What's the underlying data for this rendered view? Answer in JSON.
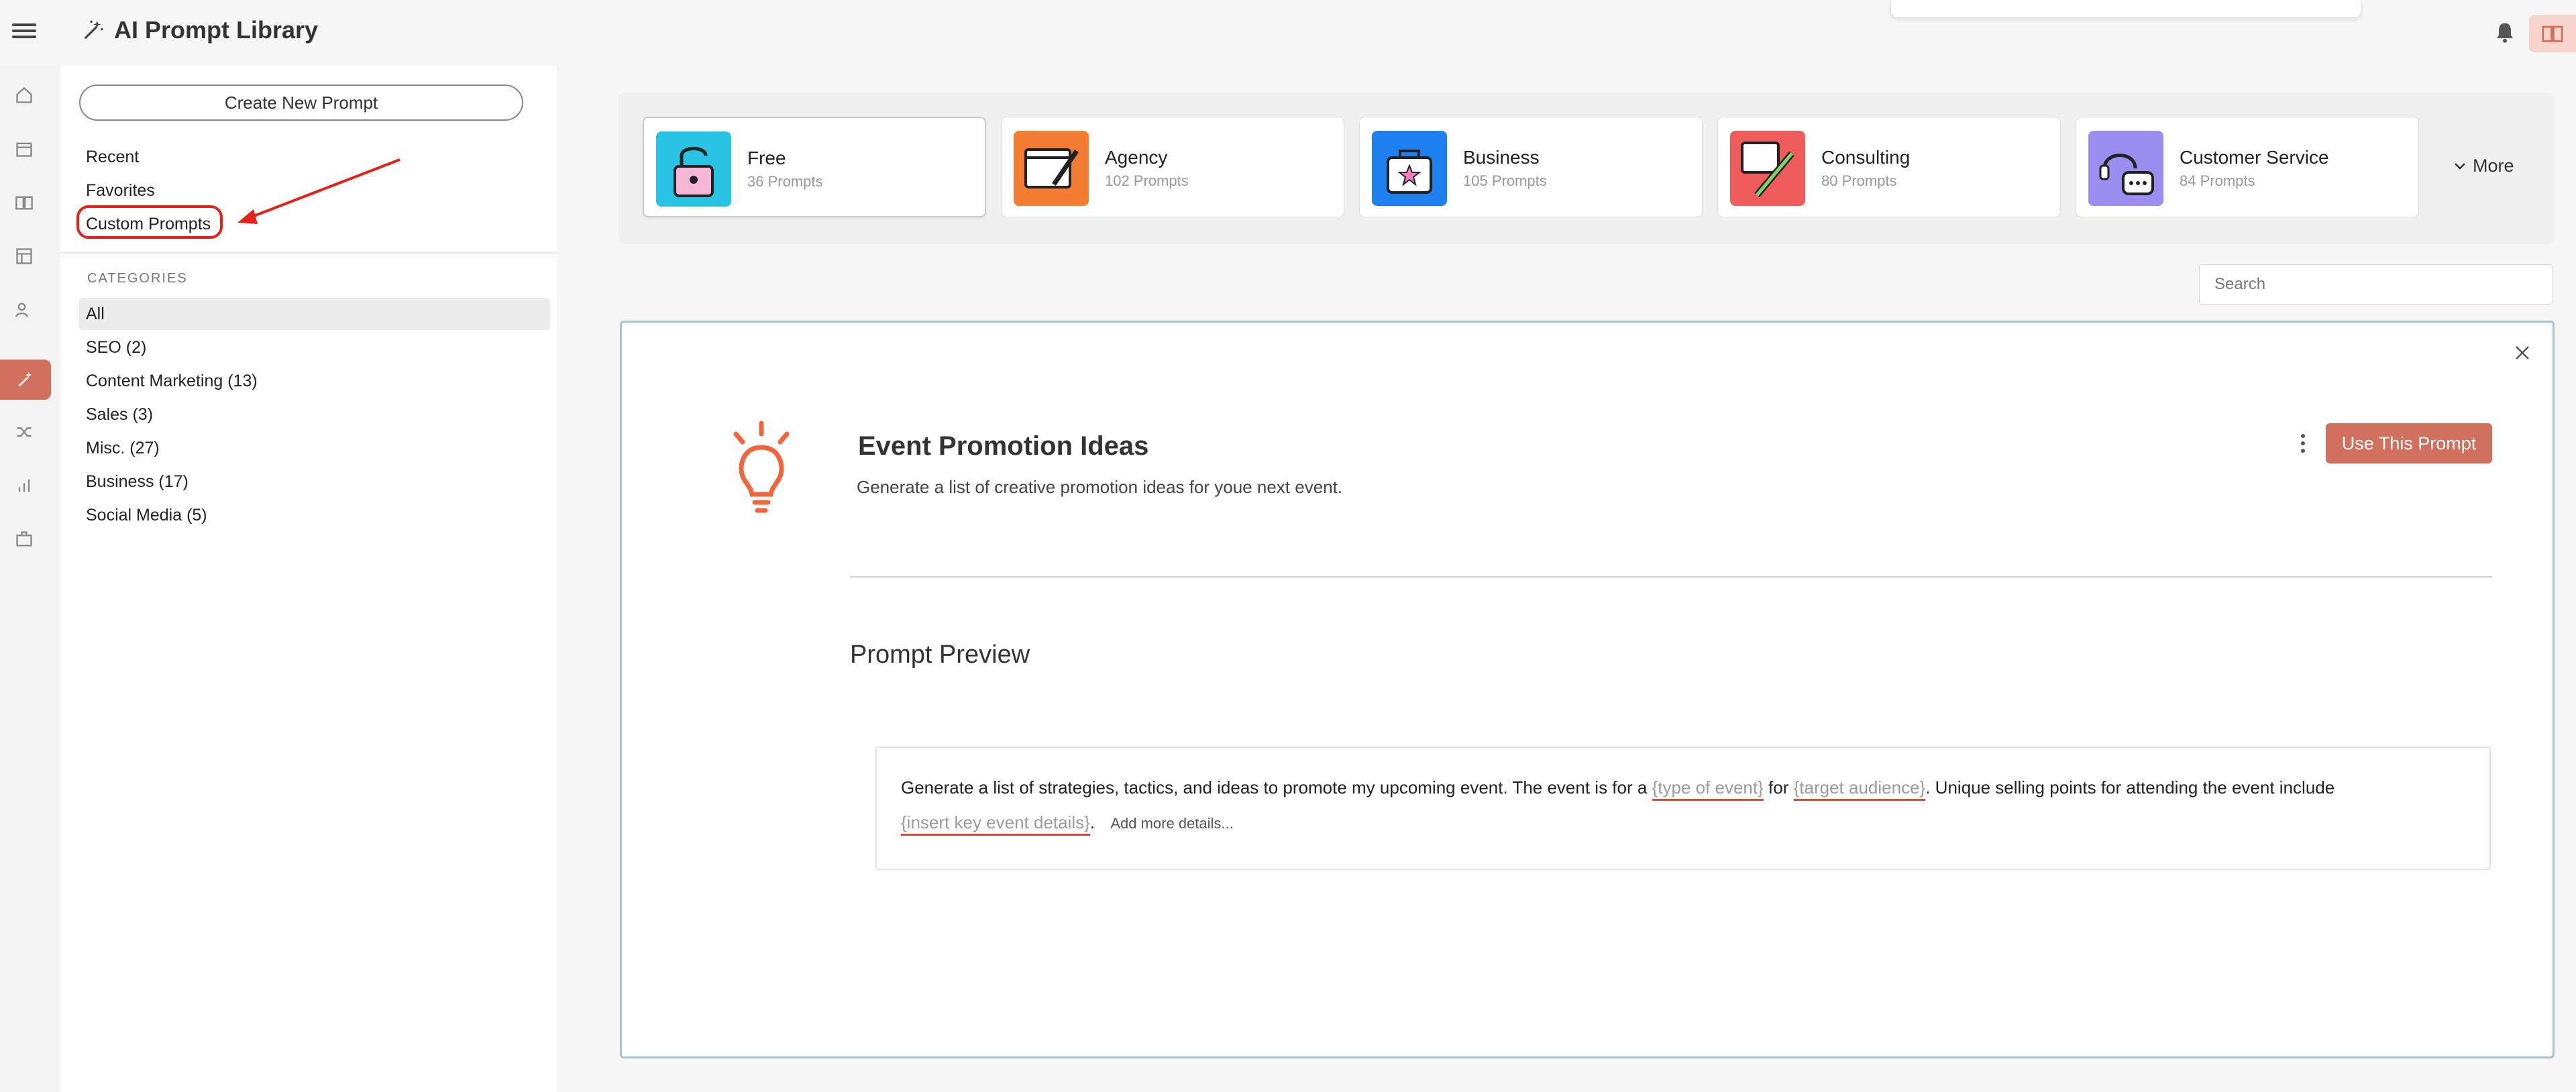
{
  "header": {
    "title": "AI Prompt Library",
    "icons": [
      "menu-icon",
      "magic-wand-icon",
      "bell-icon",
      "book-icon"
    ]
  },
  "rail": {
    "icons": [
      "home-icon",
      "calendar-icon",
      "book-open-icon",
      "layout-icon",
      "users-icon",
      "magic-wand-icon",
      "shuffle-icon",
      "bar-chart-icon",
      "briefcase-icon"
    ],
    "active_index": 5
  },
  "sidebar": {
    "create_label": "Create New Prompt",
    "links": [
      "Recent",
      "Favorites",
      "Custom Prompts"
    ],
    "categories_heading": "CATEGORIES",
    "categories": [
      "All",
      "SEO (2)",
      "Content Marketing (13)",
      "Sales (3)",
      "Misc. (27)",
      "Business (17)",
      "Social Media (5)"
    ]
  },
  "cards": [
    {
      "name": "Free",
      "count": "36 Prompts",
      "color": "#29c3e4"
    },
    {
      "name": "Agency",
      "count": "102 Prompts",
      "color": "#f47d33"
    },
    {
      "name": "Business",
      "count": "105 Prompts",
      "color": "#1e80ee"
    },
    {
      "name": "Consulting",
      "count": "80 Prompts",
      "color": "#f05c5c"
    },
    {
      "name": "Customer Service",
      "count": "84 Prompts",
      "color": "#9b8ef0"
    }
  ],
  "more_label": "More",
  "search": {
    "placeholder": "Search"
  },
  "prompt": {
    "title": "Event Promotion Ideas",
    "description": "Generate a list of creative promotion ideas for youe next event.",
    "use_label": "Use This Prompt",
    "preview_heading": "Prompt Preview",
    "text_1": "Generate a list of strategies, tactics, and ideas to promote my upcoming event. The event is for a",
    "var_1": "{type of event}",
    "text_2": "for",
    "var_2": "{target audience}",
    "text_3": ". Unique selling points for attending the event include",
    "var_3": "{insert key event details}",
    "text_4": ".",
    "add_more": "Add more details..."
  },
  "colors": {
    "accent": "#d2705e",
    "highlight_circle": "#e2231a",
    "detail_border": "#a8c4cc"
  }
}
